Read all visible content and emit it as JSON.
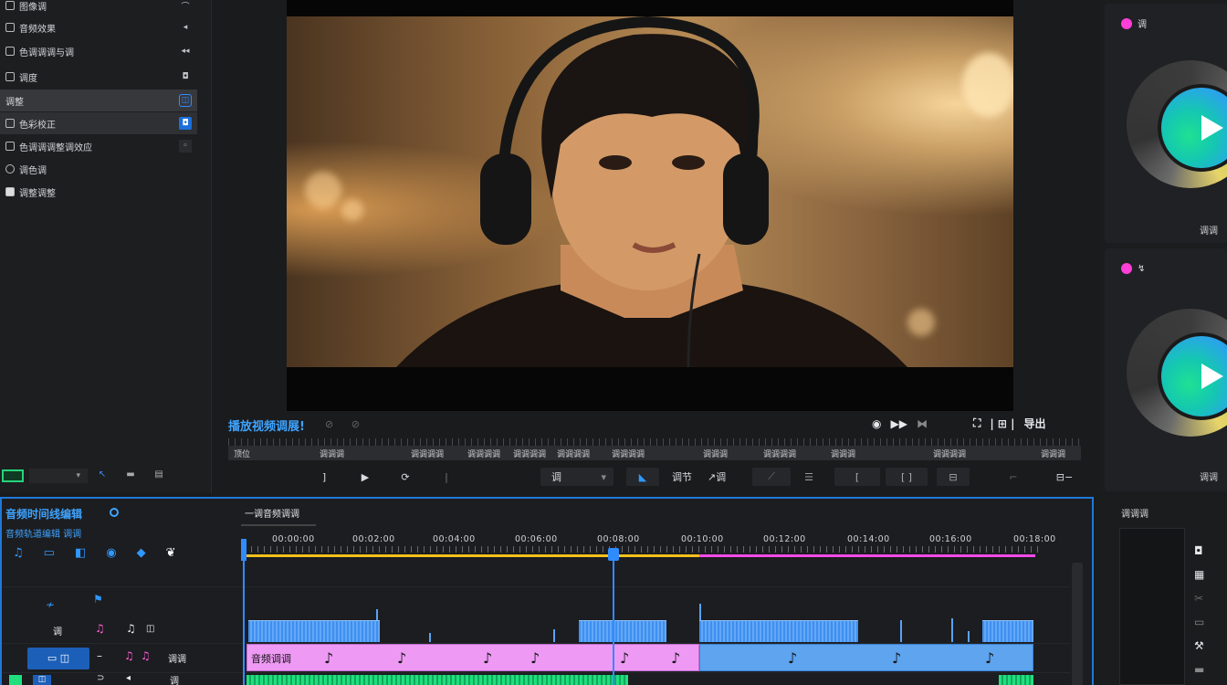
{
  "left_panel": {
    "items": [
      {
        "label": "图像调",
        "right": "⌒"
      },
      {
        "label": "音频效果",
        "right": "◂"
      },
      {
        "label": "色调调调与调",
        "right": "◂◂"
      },
      {
        "label": "调度",
        "right": "◘"
      },
      {
        "label": "调整",
        "right": "◫"
      },
      {
        "label": "色彩校正",
        "right": "◘"
      },
      {
        "label": "色调调调整调效应",
        "right": "◦"
      },
      {
        "label": "调色调",
        "right": ""
      },
      {
        "label": "调整调整",
        "right": ""
      }
    ],
    "bottom_field": "▾"
  },
  "viewer": {
    "title": "播放视频调展!",
    "title_icons": "⊘ ⊘",
    "right_tools": [
      "◉",
      "▶▶",
      "⧓",
      "⛶",
      "| ⊞ |",
      "导出"
    ],
    "ruler_labels": [
      "顶位",
      "调调调",
      "调调调调",
      "调调调调",
      "调调调调",
      "调调调调",
      "调调调调",
      "调调调",
      "调调调调",
      "调调调",
      "调调调调",
      "调调调"
    ],
    "transport": {
      "mark_in": "]",
      "play": "▶",
      "loop": "⟳",
      "sep": "|",
      "dropdown": "调",
      "snap": "◣",
      "fit_label": "调节",
      "cut": "↗调"
    }
  },
  "right_panel": {
    "cards": [
      {
        "head": "调",
        "label": "调调"
      },
      {
        "head": "↯",
        "label": "调调"
      }
    ]
  },
  "timeline": {
    "title": "音频时间线编辑",
    "subtitle": "音频轨道编辑 调调",
    "tab": "一调音频调调",
    "ruler_labels": [
      "00:00:00",
      "00:02:00",
      "00:04:00",
      "00:06:00",
      "00:08:00",
      "00:10:00",
      "00:12:00",
      "00:14:00",
      "00:16:00",
      "00:18:00"
    ],
    "track_labels": [
      "调",
      "调调",
      "调"
    ],
    "clip_label": "音频调调"
  },
  "right_bottom": {
    "title": "调调调"
  },
  "colors": {
    "accent": "#2f8cff",
    "pink": "#f24be8",
    "yellow": "#f4c11c",
    "green": "#1fe07d",
    "magenta_dot": "#ff3fd8"
  }
}
